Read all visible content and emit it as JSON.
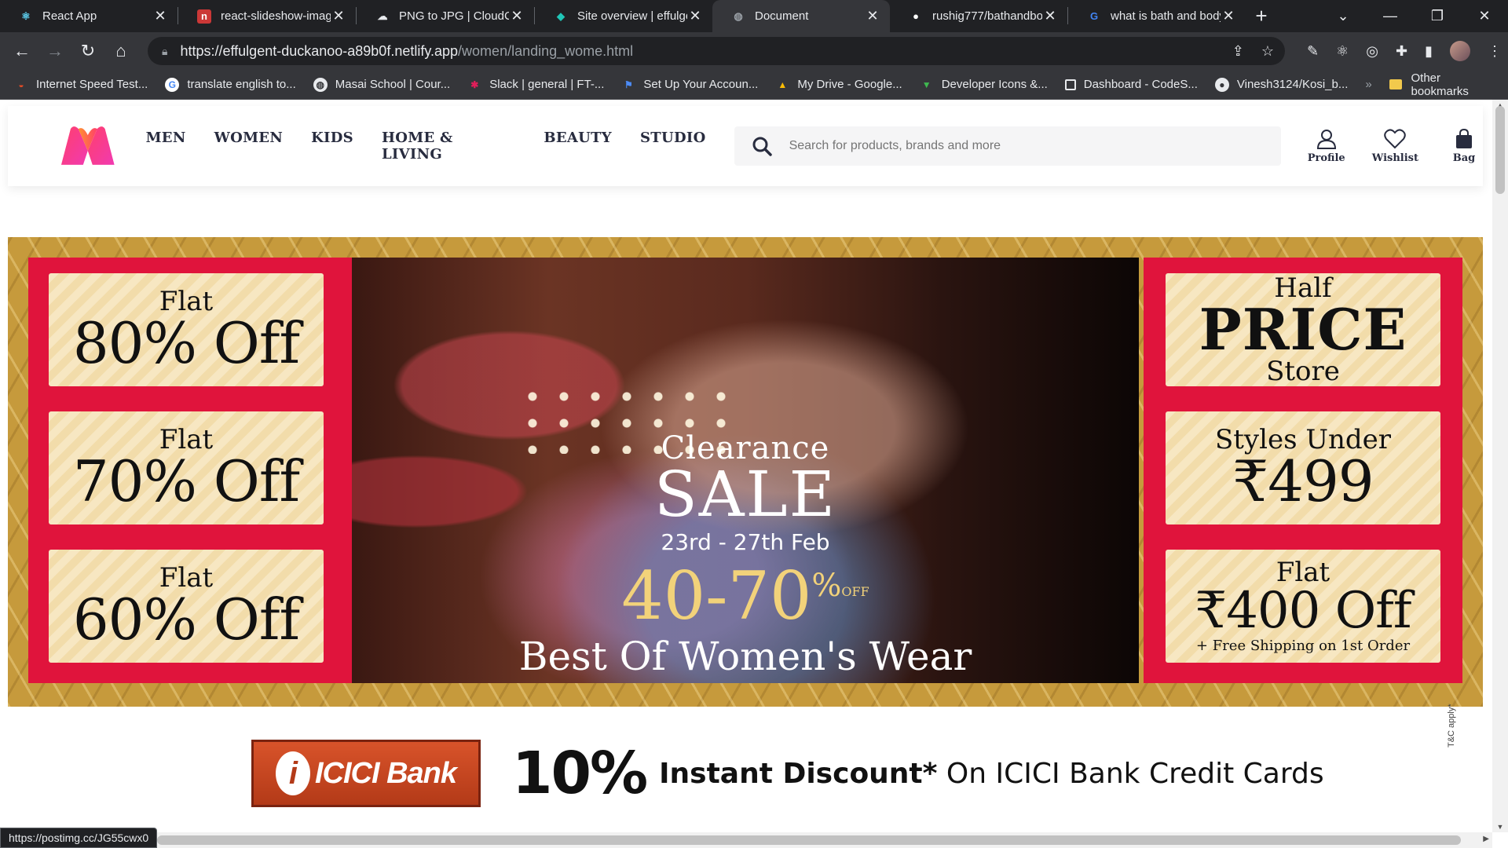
{
  "browser": {
    "tabs": [
      {
        "title": "React App",
        "active": false,
        "icon": "react-icon"
      },
      {
        "title": "react-slideshow-imag",
        "active": false,
        "icon": "npm-icon"
      },
      {
        "title": "PNG to JPG | CloudCo",
        "active": false,
        "icon": "cloudconvert-icon"
      },
      {
        "title": "Site overview | effulge",
        "active": false,
        "icon": "netlify-icon"
      },
      {
        "title": "Document",
        "active": true,
        "icon": "globe-icon"
      },
      {
        "title": "rushig777/bathandbo",
        "active": false,
        "icon": "github-icon"
      },
      {
        "title": "what is bath and body",
        "active": false,
        "icon": "google-icon"
      }
    ],
    "url": {
      "host": "https://effulgent-duckanoo-a89b0f.netlify.app",
      "path": "/women/landing_wome.html"
    },
    "bookmarks": [
      "Internet Speed Test...",
      "translate english to...",
      "Masai School | Cour...",
      "Slack | general | FT-...",
      "Set Up Your Accoun...",
      "My Drive - Google...",
      "Developer Icons &...",
      "Dashboard - CodeS...",
      "Vinesh3124/Kosi_b..."
    ],
    "bookmarks_more": "»",
    "other_bookmarks": "Other bookmarks",
    "status_url": "https://postimg.cc/JG55cwx0"
  },
  "header": {
    "nav": [
      "MEN",
      "WOMEN",
      "KIDS",
      "HOME & LIVING",
      "BEAUTY",
      "STUDIO"
    ],
    "search_placeholder": "Search for products, brands and more",
    "actions": {
      "profile": "Profile",
      "wishlist": "Wishlist",
      "bag": "Bag"
    }
  },
  "banner": {
    "left_offers": [
      {
        "top": "Flat",
        "main": "80% Off"
      },
      {
        "top": "Flat",
        "main": "70% Off"
      },
      {
        "top": "Flat",
        "main": "60% Off"
      }
    ],
    "right_offers": {
      "half_price": {
        "top": "Half",
        "main": "PRICE",
        "bottom": "Store"
      },
      "styles_under": {
        "top": "Styles Under",
        "main": "₹499"
      },
      "flat_400": {
        "top": "Flat",
        "main": "₹400 Off",
        "bottom": "+ Free Shipping on 1st Order"
      }
    },
    "center": {
      "clearance": "Clearance",
      "sale": "SALE",
      "dates": "23rd - 27th Feb",
      "discount": "40-70",
      "discount_suffix": "%",
      "discount_off": "OFF",
      "tagline": "Best Of Women's Wear"
    }
  },
  "icici": {
    "logo_text": "ICICI Bank",
    "percent": "10%",
    "bold_text": "Instant Discount*",
    "rest_text": " On ICICI Bank Credit Cards",
    "tnc": "T&C apply*"
  },
  "colors": {
    "brand_red": "#e0143c",
    "gold": "#c69a3c",
    "chrome_dark": "#202124"
  }
}
